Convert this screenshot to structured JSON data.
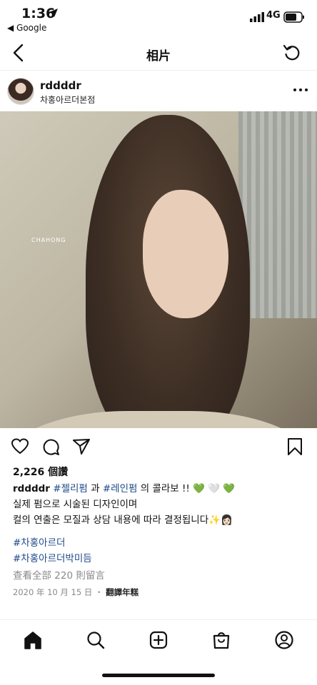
{
  "status": {
    "time": "1:36",
    "back_app": "◀ Google",
    "network": "4G"
  },
  "nav": {
    "title": "相片"
  },
  "post": {
    "username": "rddddr",
    "location": "차홍아르더본점",
    "watermark": "CHAHONG",
    "likes": "2,226 個讚",
    "caption": {
      "user": "rddddr",
      "tag1": "#젤리펌",
      "mid": " 과 ",
      "tag2": "#레인펌",
      "end": " 의 콜라보 !! ",
      "hearts_emoji": "💚 🤍 💚",
      "line2": "실제 펌으로 시술된 디자인이며",
      "line3": "컬의 연출은 모질과 상담 내용에 따라 결정됩니다✨👩🏻"
    },
    "hashtags": [
      "#차홍아르더",
      "#차홍아르더박미듬"
    ],
    "comments": "查看全部 220 則留言",
    "date": "2020 年 10 月 15 日 ・",
    "translate": "翻譯年糕"
  },
  "colors": {
    "hashtag": "#1f4a8a",
    "muted": "#8a8a8a",
    "accent_heart": "#6ac349"
  },
  "icons": [
    "location-arrow-icon",
    "signal-icon",
    "battery-icon",
    "back-chevron-icon",
    "refresh-icon",
    "more-icon",
    "heart-icon",
    "comment-icon",
    "share-icon",
    "bookmark-icon",
    "home-icon",
    "search-icon",
    "create-icon",
    "shop-icon",
    "profile-icon"
  ]
}
